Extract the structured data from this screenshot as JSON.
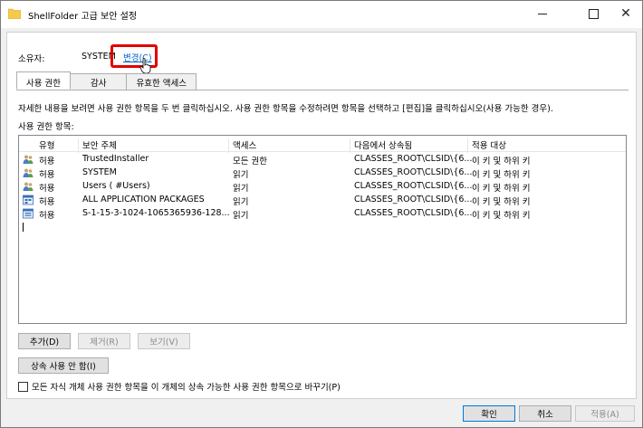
{
  "window": {
    "title": "ShellFolder 고급 보안 설정"
  },
  "owner": {
    "label": "소유자:",
    "value": "SYSTEM",
    "change_link": "변경(C)"
  },
  "tabs": [
    {
      "label": "사용 권한",
      "active": true
    },
    {
      "label": "감사",
      "active": false
    },
    {
      "label": "유효한 액세스",
      "active": false
    }
  ],
  "instructions": "자세한 내용을 보려면 사용 권한 항목을 두 번 클릭하십시오. 사용 권한 항목을 수정하려면 항목을 선택하고 [편집]을 클릭하십시오(사용 가능한 경우).",
  "entries_label": "사용 권한 항목:",
  "table": {
    "columns": [
      "유형",
      "보안 주체",
      "액세스",
      "다음에서 상속됨",
      "적용 대상"
    ],
    "rows": [
      {
        "icon": "users-icon",
        "type": "허용",
        "principal": "TrustedInstaller",
        "access": "모든 권한",
        "inherited": "CLASSES_ROOT\\CLSID\\{6...",
        "applies": "이 키 및 하위 키"
      },
      {
        "icon": "users-icon",
        "type": "허용",
        "principal": "SYSTEM",
        "access": "읽기",
        "inherited": "CLASSES_ROOT\\CLSID\\{6...",
        "applies": "이 키 및 하위 키"
      },
      {
        "icon": "users-icon",
        "type": "허용",
        "principal": "Users (                    #Users)",
        "access": "읽기",
        "inherited": "CLASSES_ROOT\\CLSID\\{6...",
        "applies": "이 키 및 하위 키"
      },
      {
        "icon": "app-packages-icon",
        "type": "허용",
        "principal": "ALL APPLICATION PACKAGES",
        "access": "읽기",
        "inherited": "CLASSES_ROOT\\CLSID\\{6...",
        "applies": "이 키 및 하위 키"
      },
      {
        "icon": "app-package-sid-icon",
        "type": "허용",
        "principal": "S-1-15-3-1024-1065365936-128...",
        "access": "읽기",
        "inherited": "CLASSES_ROOT\\CLSID\\{6...",
        "applies": "이 키 및 하위 키"
      }
    ]
  },
  "buttons": {
    "add": "추가(D)",
    "remove": "제거(R)",
    "view": "보기(V)",
    "disable_inheritance": "상속 사용 안 함(I)",
    "ok": "확인",
    "cancel": "취소",
    "apply": "적용(A)"
  },
  "checkbox_label": "모든 자식 개체 사용 권한 항목을 이 개체의 상속 가능한 사용 권한 항목으로 바꾸기(P)",
  "colors": {
    "highlight": "#e00000",
    "link": "#0066cc",
    "accent": "#0078d7"
  }
}
